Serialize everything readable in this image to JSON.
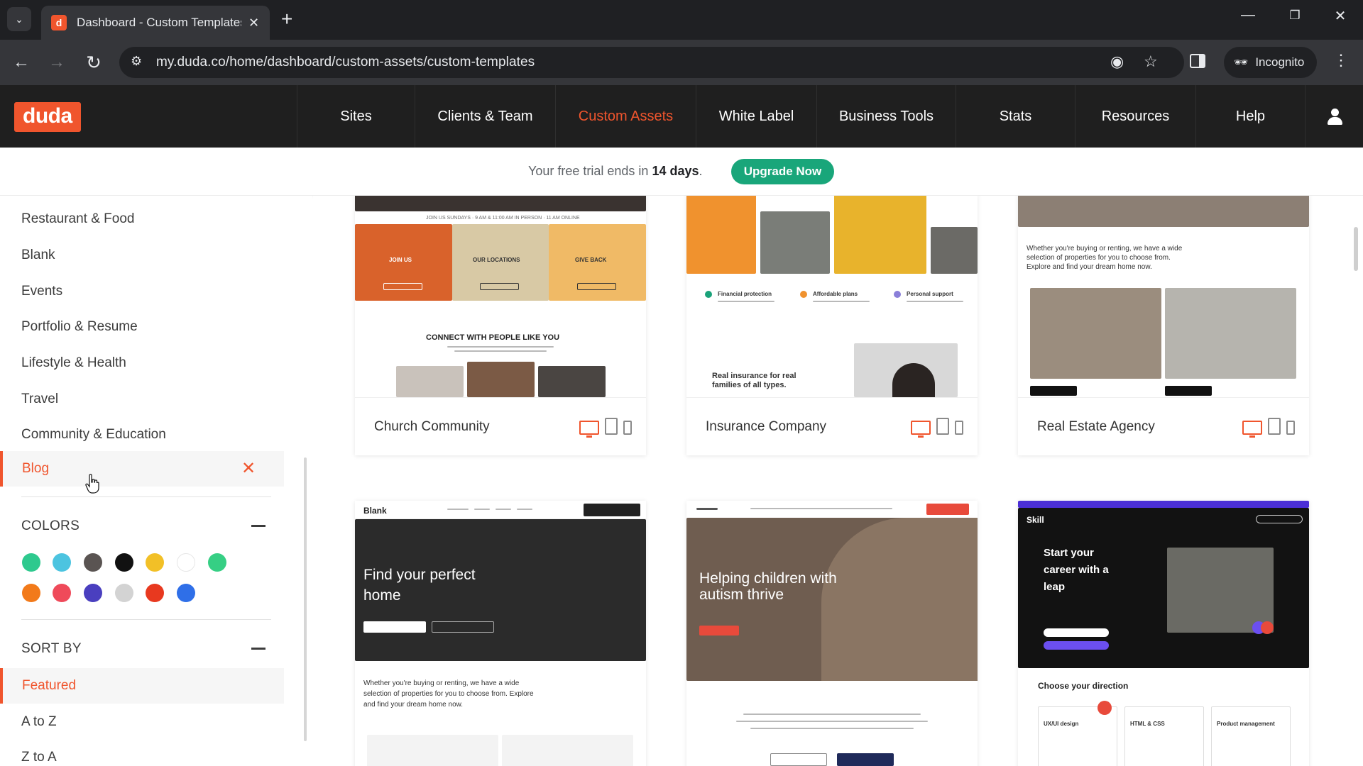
{
  "browser": {
    "tab_title": "Dashboard - Custom Templates",
    "tab_favicon_letter": "d",
    "url": "my.duda.co/home/dashboard/custom-assets/custom-templates",
    "incognito_label": "Incognito"
  },
  "header": {
    "logo": "duda",
    "nav": [
      {
        "label": "Sites",
        "active": false
      },
      {
        "label": "Clients & Team",
        "active": false
      },
      {
        "label": "Custom Assets",
        "active": true
      },
      {
        "label": "White Label",
        "active": false
      },
      {
        "label": "Business Tools",
        "active": false
      },
      {
        "label": "Stats",
        "active": false
      },
      {
        "label": "Resources",
        "active": false
      },
      {
        "label": "Help",
        "active": false
      }
    ]
  },
  "trial": {
    "text_prefix": "Your free trial ends in ",
    "days": "14 days",
    "text_suffix": ".",
    "button": "Upgrade Now"
  },
  "sidebar": {
    "categories": [
      "Restaurant & Food",
      "Blank",
      "Events",
      "Portfolio & Resume",
      "Lifestyle & Health",
      "Travel",
      "Community & Education"
    ],
    "selected_category": "Blog",
    "colors_title": "COLORS",
    "colors": [
      "#2ec98e",
      "#4cc4e0",
      "#5a5452",
      "#111111",
      "#f2c027",
      "#ffffff",
      "#36cf84",
      "#f27a1a",
      "#ef4a5a",
      "#4a3fbf",
      "#d3d3d3",
      "#e8391f",
      "#2f6fe8"
    ],
    "sort_title": "SORT BY",
    "sort_options": [
      "Featured",
      "A to Z",
      "Z to A"
    ],
    "sort_selected": "Featured"
  },
  "templates": [
    {
      "name": "Church Community",
      "thumb": {
        "tagline": "JOIN US SUNDAYS · 9 AM & 11:00 AM IN PERSON · 11 AM ONLINE",
        "boxes": [
          "JOIN US",
          "OUR LOCATIONS",
          "GIVE BACK"
        ],
        "heading": "CONNECT WITH PEOPLE LIKE YOU"
      }
    },
    {
      "name": "Insurance Company",
      "thumb": {
        "features": [
          "Financial protection",
          "Affordable plans",
          "Personal support"
        ],
        "heading": "Real insurance for real families of all types."
      }
    },
    {
      "name": "Real Estate Agency",
      "thumb": {
        "intro": "Whether you're buying or renting, we have a wide selection of properties for you to choose from. Explore and find your dream home now."
      }
    },
    {
      "name": "",
      "thumb": {
        "brand": "Blank",
        "headline": "Find your perfect home",
        "intro": "Whether you're buying or renting, we have a wide selection of properties for you to choose from. Explore and find your dream home now."
      }
    },
    {
      "name": "",
      "thumb": {
        "headline": "Helping children with autism thrive"
      }
    },
    {
      "name": "",
      "thumb": {
        "brand": "Skill",
        "headline": "Start your career with a leap",
        "section": "Choose your direction",
        "directions": [
          "UX/UI design",
          "HTML & CSS",
          "Product management"
        ]
      }
    }
  ]
}
